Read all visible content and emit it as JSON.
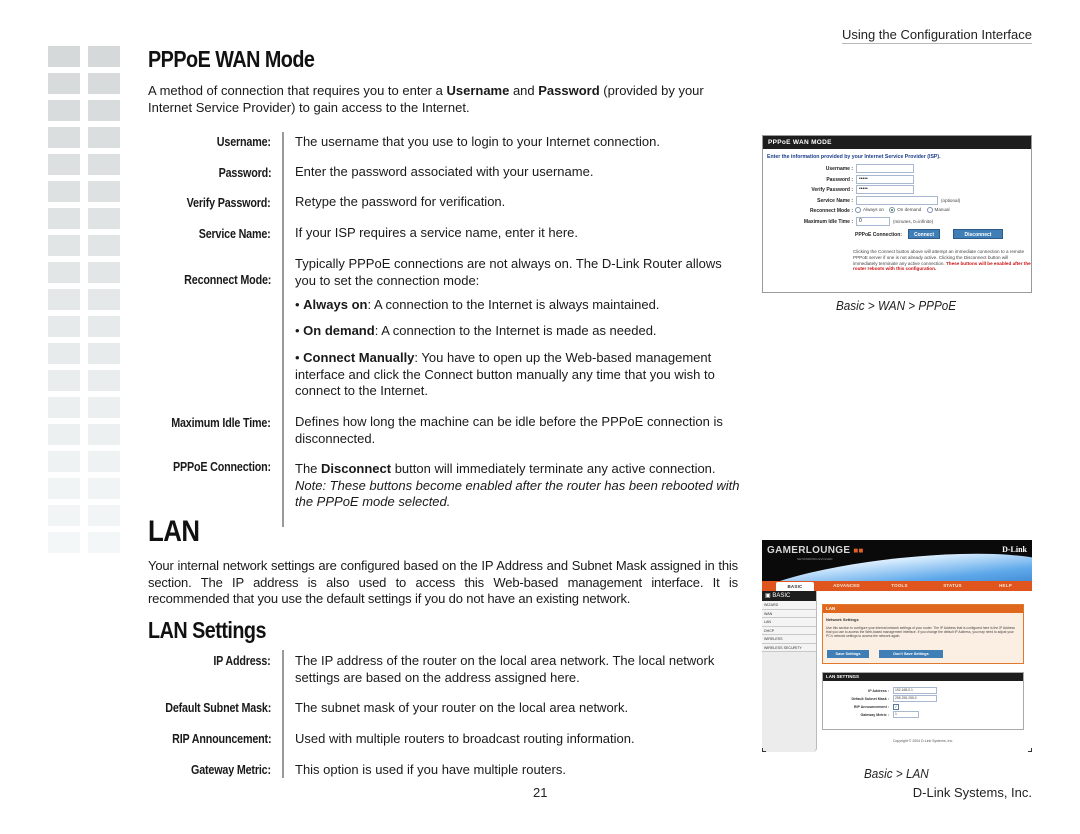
{
  "header": {
    "section_title": "Using the Configuration Interface"
  },
  "pppoe": {
    "title": "PPPoE WAN Mode",
    "intro_parts": [
      "A method of connection that requires you to enter a ",
      "Username",
      " and ",
      "Password",
      " (provided by your Internet Service Provider) to gain access to the Internet."
    ],
    "fields": [
      {
        "label": "Username:",
        "desc": "The username that you use to login to your Internet connection."
      },
      {
        "label": "Password:",
        "desc": "Enter the password associated with your username."
      },
      {
        "label": "Verify Password:",
        "desc": "Retype the password for verification."
      },
      {
        "label": "Service Name:",
        "desc": "If your ISP requires a service name, enter it here."
      },
      {
        "label": "Reconnect Mode:",
        "desc": "Typically PPPoE connections are not always on. The D-Link Router allows you to set the connection mode:"
      },
      {
        "label": "Maximum Idle Time:",
        "desc": "Defines how long the machine can be idle before the PPPoE connection is disconnected."
      },
      {
        "label": "PPPoE Connection:",
        "desc_pre": "The ",
        "desc_bold": "Disconnect",
        "desc_post": " button will immediately terminate any active connection.",
        "note": "Note: These buttons become enabled after the router has been rebooted with the PPPoE mode selected."
      }
    ],
    "modes": [
      {
        "name": "Always on",
        "text": ": A connection to the Internet is always maintained."
      },
      {
        "name": "On demand",
        "text": ": A connection to the Internet is made as needed."
      },
      {
        "name": "Connect Manually",
        "text": ": You have to open up the Web-based management interface and click the Connect button manually any time that you wish to connect to the Internet."
      }
    ],
    "screenshot": {
      "header": "PPPoE WAN MODE",
      "intro": "Enter the information provided by your Internet Service Provider (ISP).",
      "username_label": "Username :",
      "username_value": "",
      "password_label": "Password :",
      "password_value": "•••••",
      "verify_label": "Verify Password :",
      "verify_value": "•••••",
      "service_label": "Service Name :",
      "service_value": "",
      "service_note": "(optional)",
      "reconnect_label": "Reconnect Mode :",
      "reconnect_options": [
        "Always on",
        "On demand",
        "Manual"
      ],
      "reconnect_selected": "On demand",
      "idle_label": "Maximum Idle Time :",
      "idle_value": "0",
      "idle_note": "(minutes, 0=infinite)",
      "connection_label": "PPPoE Connection:",
      "connect_button": "Connect",
      "disconnect_button": "Disconnect",
      "help_text": "Clicking the Connect button above will attempt an immediate connection to a remote PPPoE server if one is not already active. Clicking the Disconnect button will immediately terminate any active connection.",
      "warning_text": "These buttons will be enabled after the router reboots with this configuration."
    },
    "caption": "Basic > WAN > PPPoE"
  },
  "lan": {
    "title": "LAN",
    "intro": "Your internal network settings are configured based on the IP Address and Subnet Mask assigned in this section. The IP address is also used to access this Web-based management interface. It is recommended that you use the default settings if you do not have an existing network.",
    "settings_title": "LAN Settings",
    "fields": [
      {
        "label": "IP  Address:",
        "desc": "The IP address of the router on the local area network. The local network settings are based on the address assigned here."
      },
      {
        "label": "Default Subnet Mask:",
        "desc": "The subnet mask of your router on the local area network."
      },
      {
        "label": "RIP Announcement:",
        "desc": "Used with multiple routers to broadcast routing information."
      },
      {
        "label": "Gateway Metric:",
        "desc": "This option is used if you have multiple routers."
      }
    ],
    "screenshot": {
      "logo": "GAMERLOUNGE",
      "tagline": "NETWORKING EVOLVED",
      "brand": "D-Link",
      "tabs": [
        "BASIC",
        "ADVANCED",
        "TOOLS",
        "STATUS",
        "HELP"
      ],
      "active_tab": "BASIC",
      "sidebar_title": "BASIC",
      "sidebar_items": [
        "WIZARD",
        "WAN",
        "LAN",
        "DHCP",
        "WIRELESS",
        "WIRELESS SECURITY"
      ],
      "panel_title": "LAN",
      "panel_subtitle": "Network Settings",
      "panel_desc": "Use this section to configure your internal network settings of your router. The IP Address that is configured here is the IP Address that you use to access the Web-based management interface. If you change the default IP Address, you may need to adjust your PC's network settings to access the network again.",
      "save_button": "Save Settings",
      "dont_save_button": "Don't Save Settings",
      "lan_settings_header": "LAN SETTINGS",
      "ip_label": "IP Address :",
      "ip_value": "192.168.0.1",
      "mask_label": "Default Subnet Mask :",
      "mask_value": "255.255.255.0",
      "rip_label": "RIP Announcement :",
      "rip_checked": true,
      "metric_label": "Gateway Metric :",
      "metric_value": "1",
      "copyright": "Copyright © 2004 D-Link Systems, Inc."
    },
    "caption": "Basic > LAN"
  },
  "footer": {
    "page_number": "21",
    "company": "D-Link Systems, Inc."
  }
}
